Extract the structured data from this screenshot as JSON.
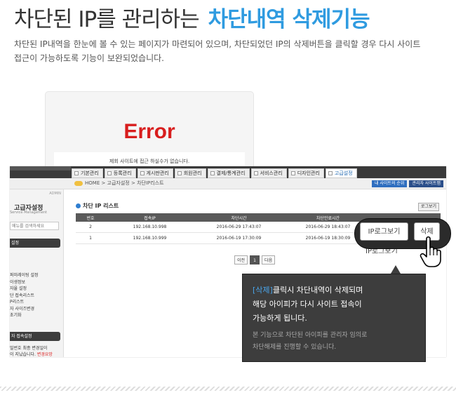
{
  "hero": {
    "title_plain": "차단된 IP를 관리하는",
    "title_accent": "차단내역 삭제기능",
    "desc_line1": "차단된 IP내역을 한눈에 볼 수 있는 페이지가 마련되어 있으며, 차단되었던 IP의 삭제버튼을 클릭할 경우 다시 사이트",
    "desc_line2": "접근이 가능하도록 기능이 보완되었습니다."
  },
  "error_card": {
    "title": "Error",
    "message": "제회 사이트에 접근 하실수가 없습니다."
  },
  "admin": {
    "menu": [
      "기본관리",
      "등록관리",
      "게시판관리",
      "회원관리",
      "결제/통계관리",
      "서비스관리",
      "디자인관리",
      "고급설정"
    ],
    "active_menu": "고급설정",
    "breadcrumb": "HOME > 고급자설정 > 차단IP리스트",
    "toolbar_buttons": [
      "내 사이트의 순위",
      "관리자 사이트맵"
    ],
    "side": {
      "admin_tag": "ADMIN",
      "title": "고급자설정",
      "subtitle": "Service Management",
      "search_placeholder": "메뉴를 검색하세요",
      "section1": "설정",
      "items": [
        "퍼미레이팅 설정",
        "이생정보",
        "자율 설정",
        "단 접속리스트",
        "P리스트",
        "자 사이즈변경",
        "초기화"
      ],
      "section2": "자 접속설정",
      "note1": "밀번호 최종 변경일이",
      "note2_prefix": "이 지났습니다.",
      "note2_red": "변경요망"
    },
    "content": {
      "title": "차단 IP 리스트",
      "log_button": "로그보기",
      "columns": [
        "번호",
        "접속IP",
        "차단시간",
        "차단만료시간",
        ""
      ],
      "rows": [
        {
          "no": "2",
          "ip": "192.168.10.998",
          "blocked": "2016-06-29 17:43:07",
          "expires": "2016-06-29 18:43:07"
        },
        {
          "no": "1",
          "ip": "192.168.10.999",
          "blocked": "2016-06-19 17:30:09",
          "expires": "2016-06-19 18:30:09"
        }
      ],
      "pager": {
        "prev": "이전",
        "current": "1",
        "next": "다음"
      }
    },
    "zoom": {
      "ip_log_button": "IP로그보기",
      "delete_button": "삭제",
      "ghost_label": "IP로그보기"
    }
  },
  "tooltip": {
    "highlight": "[삭제]",
    "line1_rest": "클릭시 차단내역이 삭제되며",
    "line2": "해당 아이피가 다시 사이트 접속이",
    "line3": "가능하게 됩니다.",
    "note1": "본 기능으로 차단된 아이피를 관리자 임의로",
    "note2": "차단해제를 진행할 수 있습니다."
  },
  "colors": {
    "accent": "#2f9be0",
    "error_red": "#d81e1e",
    "tooltip_bg": "#3d3d3d"
  }
}
